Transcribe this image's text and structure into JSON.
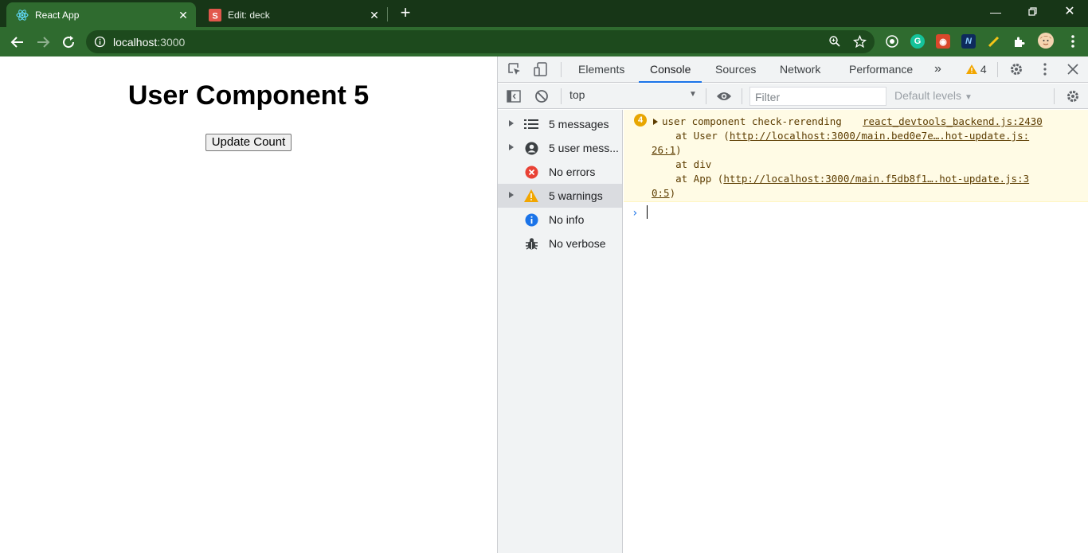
{
  "browser": {
    "tabs": [
      {
        "title": "React App",
        "active": true
      },
      {
        "title": "Edit: deck",
        "active": false
      }
    ],
    "address": {
      "host": "localhost",
      "port": ":3000"
    },
    "colors": {
      "frame": "#173617",
      "toolbar": "#2f6b2f"
    }
  },
  "page": {
    "heading": "User Component 5",
    "button_label": "Update Count"
  },
  "devtools": {
    "tabs": [
      "Elements",
      "Console",
      "Sources",
      "Network",
      "Performance"
    ],
    "active_tab": "Console",
    "warning_count": "4",
    "context": "top",
    "filter_placeholder": "Filter",
    "levels_label": "Default levels",
    "sidebar": [
      {
        "label": "5 messages",
        "icon": "list-icon",
        "expandable": true
      },
      {
        "label": "5 user mess...",
        "icon": "user-icon",
        "expandable": true
      },
      {
        "label": "No errors",
        "icon": "error-icon",
        "expandable": false
      },
      {
        "label": "5 warnings",
        "icon": "warning-icon",
        "expandable": true,
        "selected": true
      },
      {
        "label": "No info",
        "icon": "info-icon",
        "expandable": false
      },
      {
        "label": "No verbose",
        "icon": "bug-icon",
        "expandable": false
      }
    ],
    "message": {
      "repeat_count": "4",
      "text": "user component check-rerending",
      "source": "react_devtools_backend.js:2430",
      "stack": [
        {
          "prefix": "    at User (",
          "link": "http://localhost:3000/main.bed0e7e….hot-update.js:",
          "link2": "26:1",
          "suffix": ")"
        },
        {
          "prefix": "    at div",
          "link": "",
          "link2": "",
          "suffix": ""
        },
        {
          "prefix": "    at App (",
          "link": "http://localhost:3000/main.f5db8f1….hot-update.js:3",
          "link2": "0:5",
          "suffix": ")"
        }
      ]
    }
  }
}
